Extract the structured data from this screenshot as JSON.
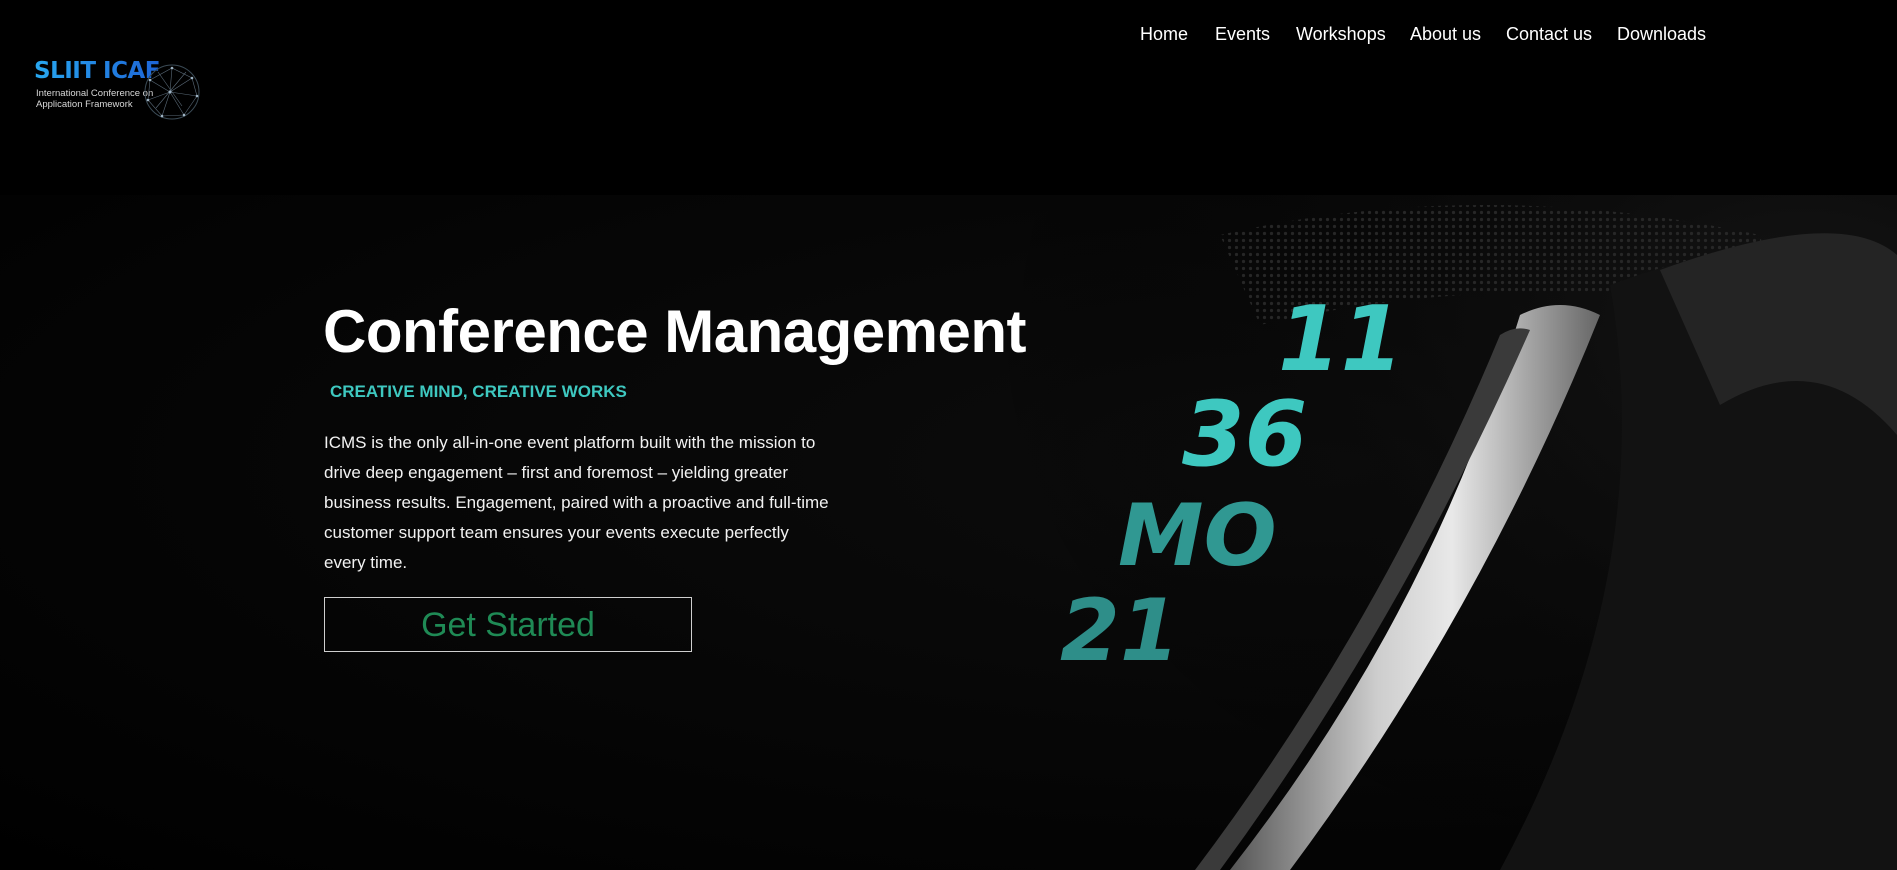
{
  "header": {
    "logo": {
      "title": "SLIIT ICAF",
      "subtitle_line1": "International Conference on",
      "subtitle_line2": "Application Framework",
      "icon": "globe-network-icon"
    },
    "nav": {
      "home": "Home",
      "events": "Events",
      "workshops": "Workshops",
      "about": "About us",
      "contact": "Contact us",
      "downloads": "Downloads"
    }
  },
  "hero": {
    "title": "Conference Management",
    "tagline": "CREATIVE MIND, CREATIVE WORKS",
    "description": "ICMS is the only all-in-one event platform built with the mission to drive deep engagement – first and foremost – yielding greater business results. Engagement, paired with a proactive and full-time customer support team ensures your events execute perfectly every time.",
    "cta_label": "Get Started",
    "image": {
      "subject": "fitness-tracker-band-image",
      "display_lines": [
        "11",
        "36",
        "MO",
        "21"
      ]
    }
  },
  "colors": {
    "background": "#000000",
    "accent_teal": "#3ec8c0",
    "cta_text": "#1f8a55",
    "logo_blue": "#1f8fe0"
  }
}
